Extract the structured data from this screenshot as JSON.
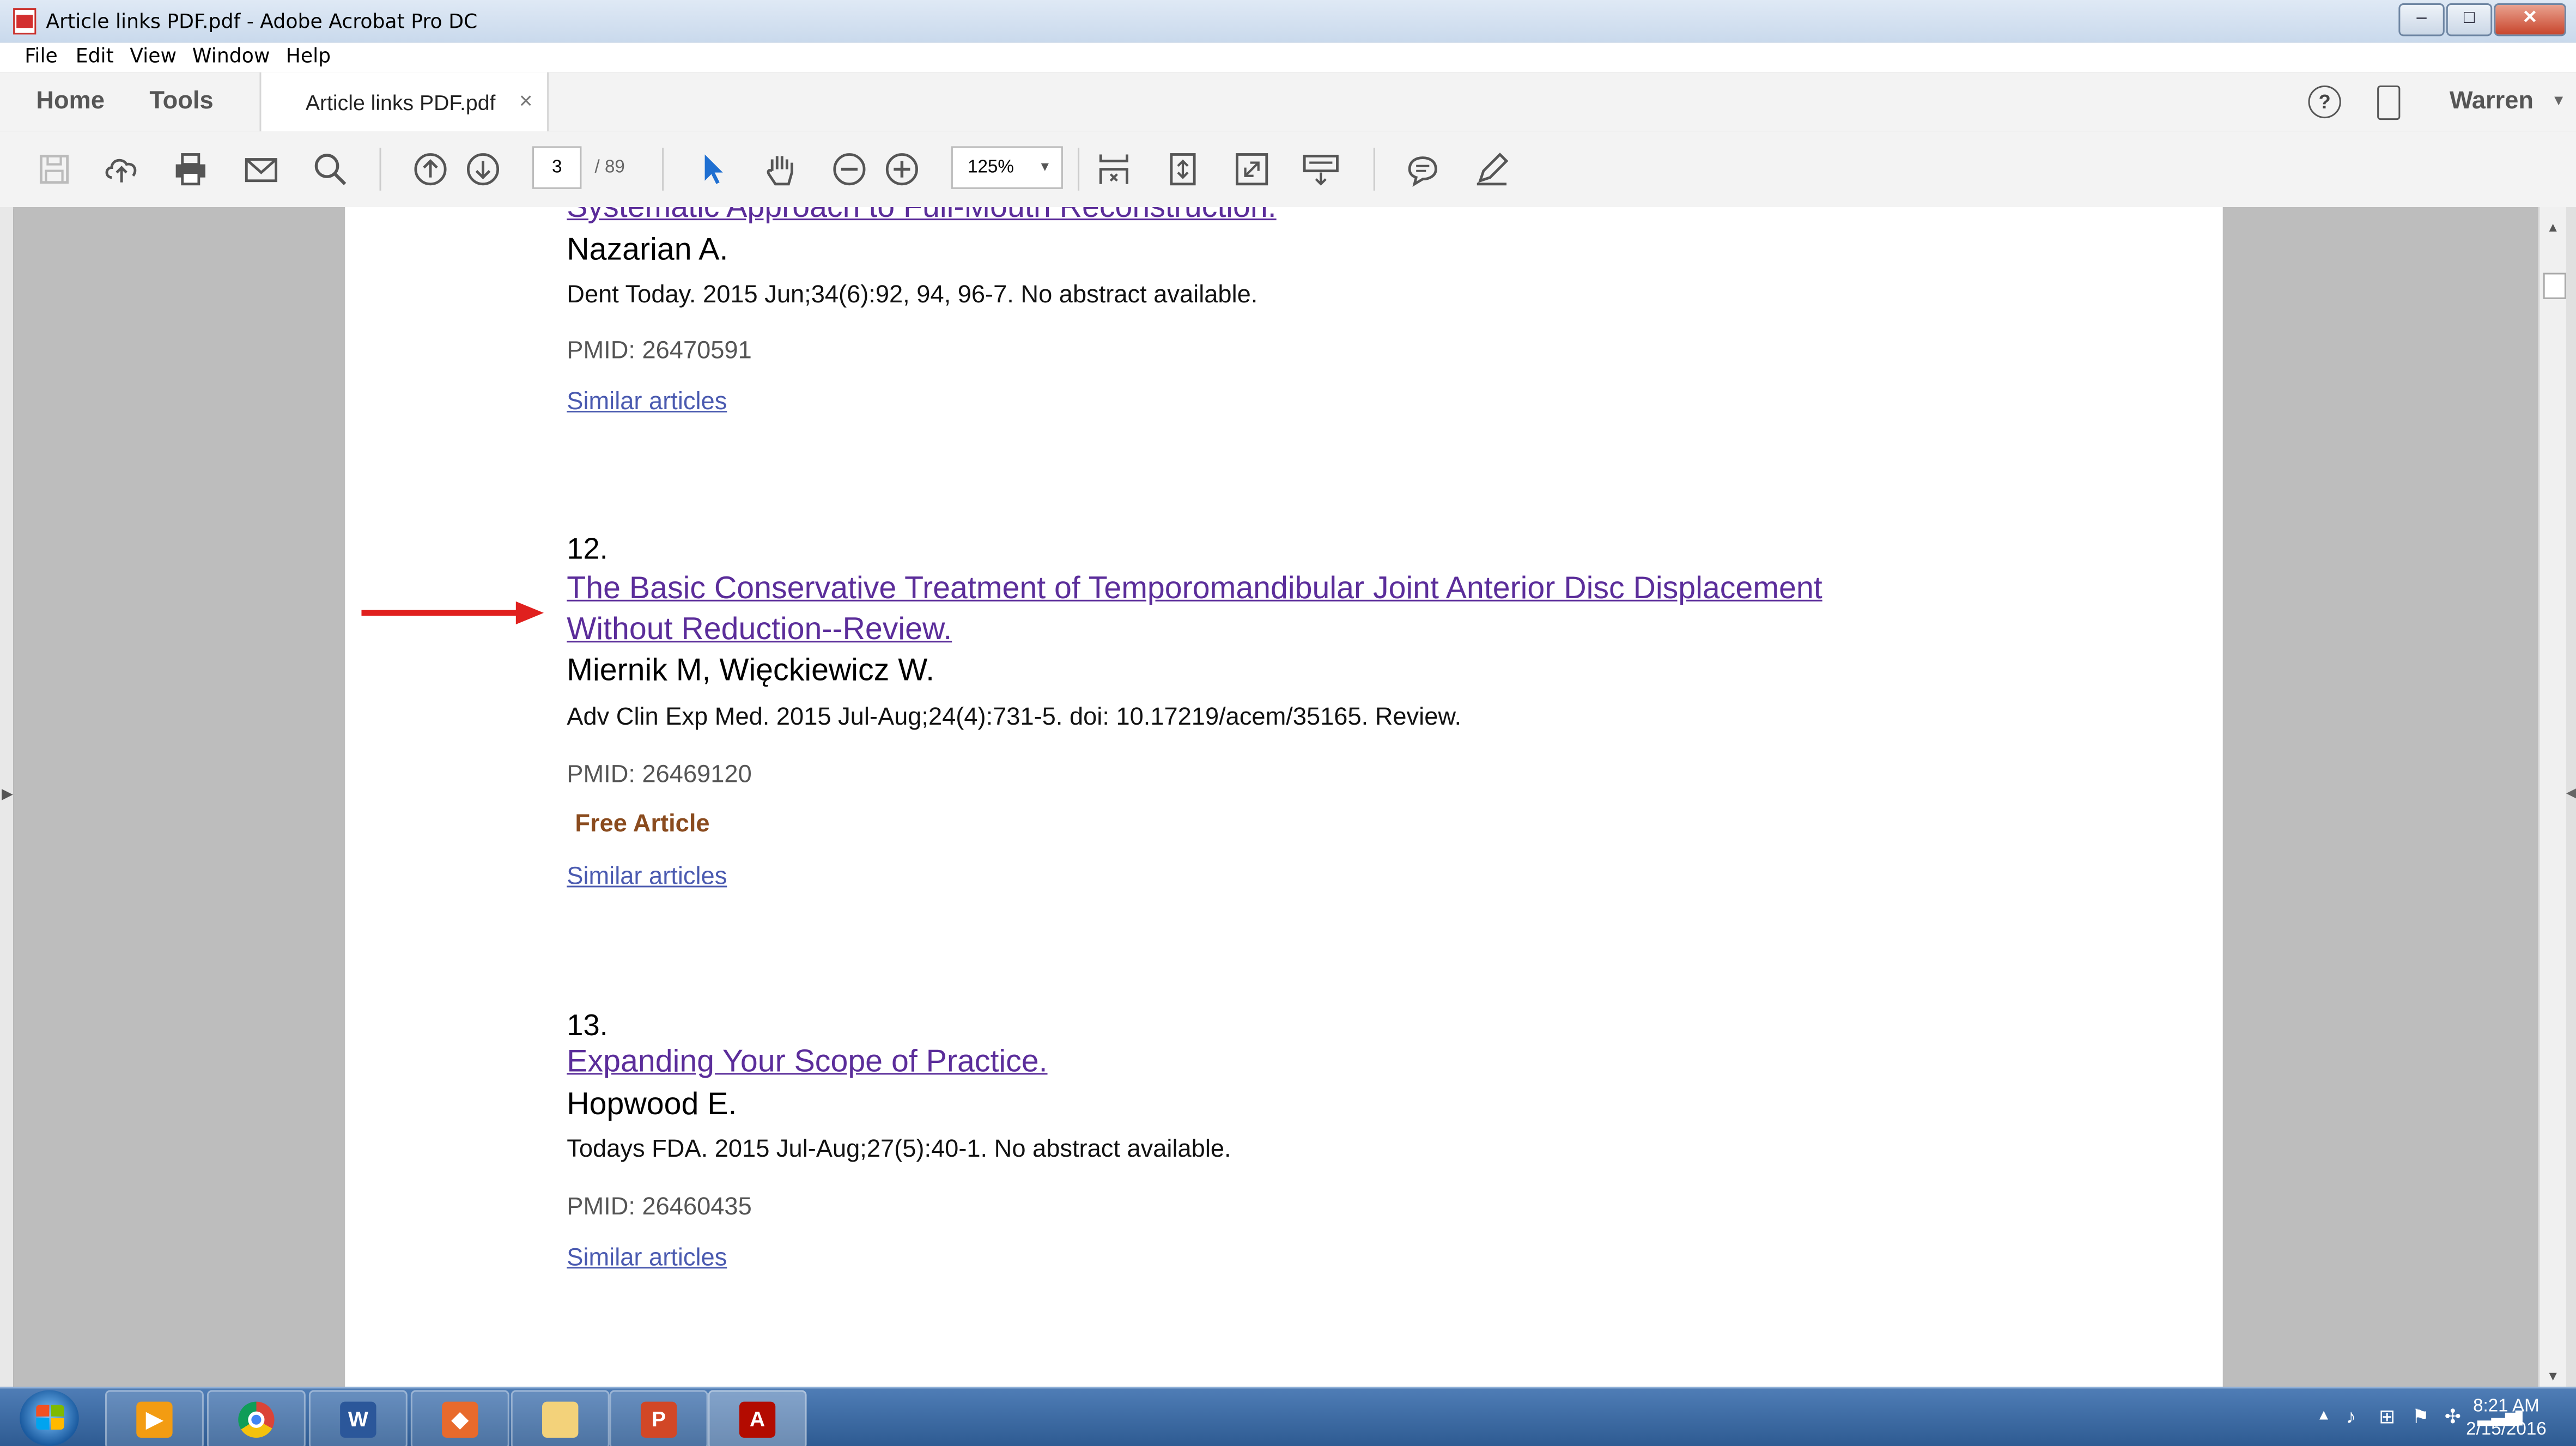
{
  "window": {
    "title": "Article links PDF.pdf - Adobe Acrobat Pro DC",
    "minimize": "–",
    "maximize": "□",
    "close": "✕"
  },
  "menu": [
    "File",
    "Edit",
    "View",
    "Window",
    "Help"
  ],
  "tabs": {
    "home": "Home",
    "tools": "Tools",
    "doc": "Article links PDF.pdf",
    "close": "×"
  },
  "account": {
    "user": "Warren",
    "help": "?"
  },
  "toolbar": {
    "page": "3",
    "total": "/ 89",
    "zoom": "125%"
  },
  "articles": {
    "prev": {
      "title_tail": "Systematic Approach to Full-Mouth Reconstruction.",
      "authors": "Nazarian A.",
      "citation": "Dent Today. 2015 Jun;34(6):92, 94, 96-7. No abstract available.",
      "pmid": "PMID: 26470591",
      "similar": "Similar articles"
    },
    "a12": {
      "number": "12.",
      "title_line1": "The Basic Conservative Treatment of Temporomandibular Joint Anterior Disc Displacement",
      "title_line2": "Without Reduction--Review.",
      "authors": "Miernik M, Więckiewicz W.",
      "citation": "Adv Clin Exp Med. 2015 Jul-Aug;24(4):731-5. doi: 10.17219/acem/35165. Review.",
      "pmid": "PMID: 26469120",
      "free": "Free Article",
      "similar": "Similar articles"
    },
    "a13": {
      "number": "13.",
      "title": "Expanding Your Scope of Practice.",
      "authors": "Hopwood E.",
      "citation": "Todays FDA. 2015 Jul-Aug;27(5):40-1. No abstract available.",
      "pmid": "PMID: 26460435",
      "similar": "Similar articles"
    }
  },
  "taskbar": {
    "apps": [
      "media-player",
      "chrome",
      "word",
      "ppt-viewer",
      "file-explorer",
      "powerpoint",
      "acrobat"
    ],
    "time": "8:21 AM",
    "date": "2/15/2016"
  },
  "colors": {
    "link": "#5b2d9a",
    "similar": "#4a5ab0",
    "free": "#8a4b1e",
    "arrow": "#e0201e"
  }
}
